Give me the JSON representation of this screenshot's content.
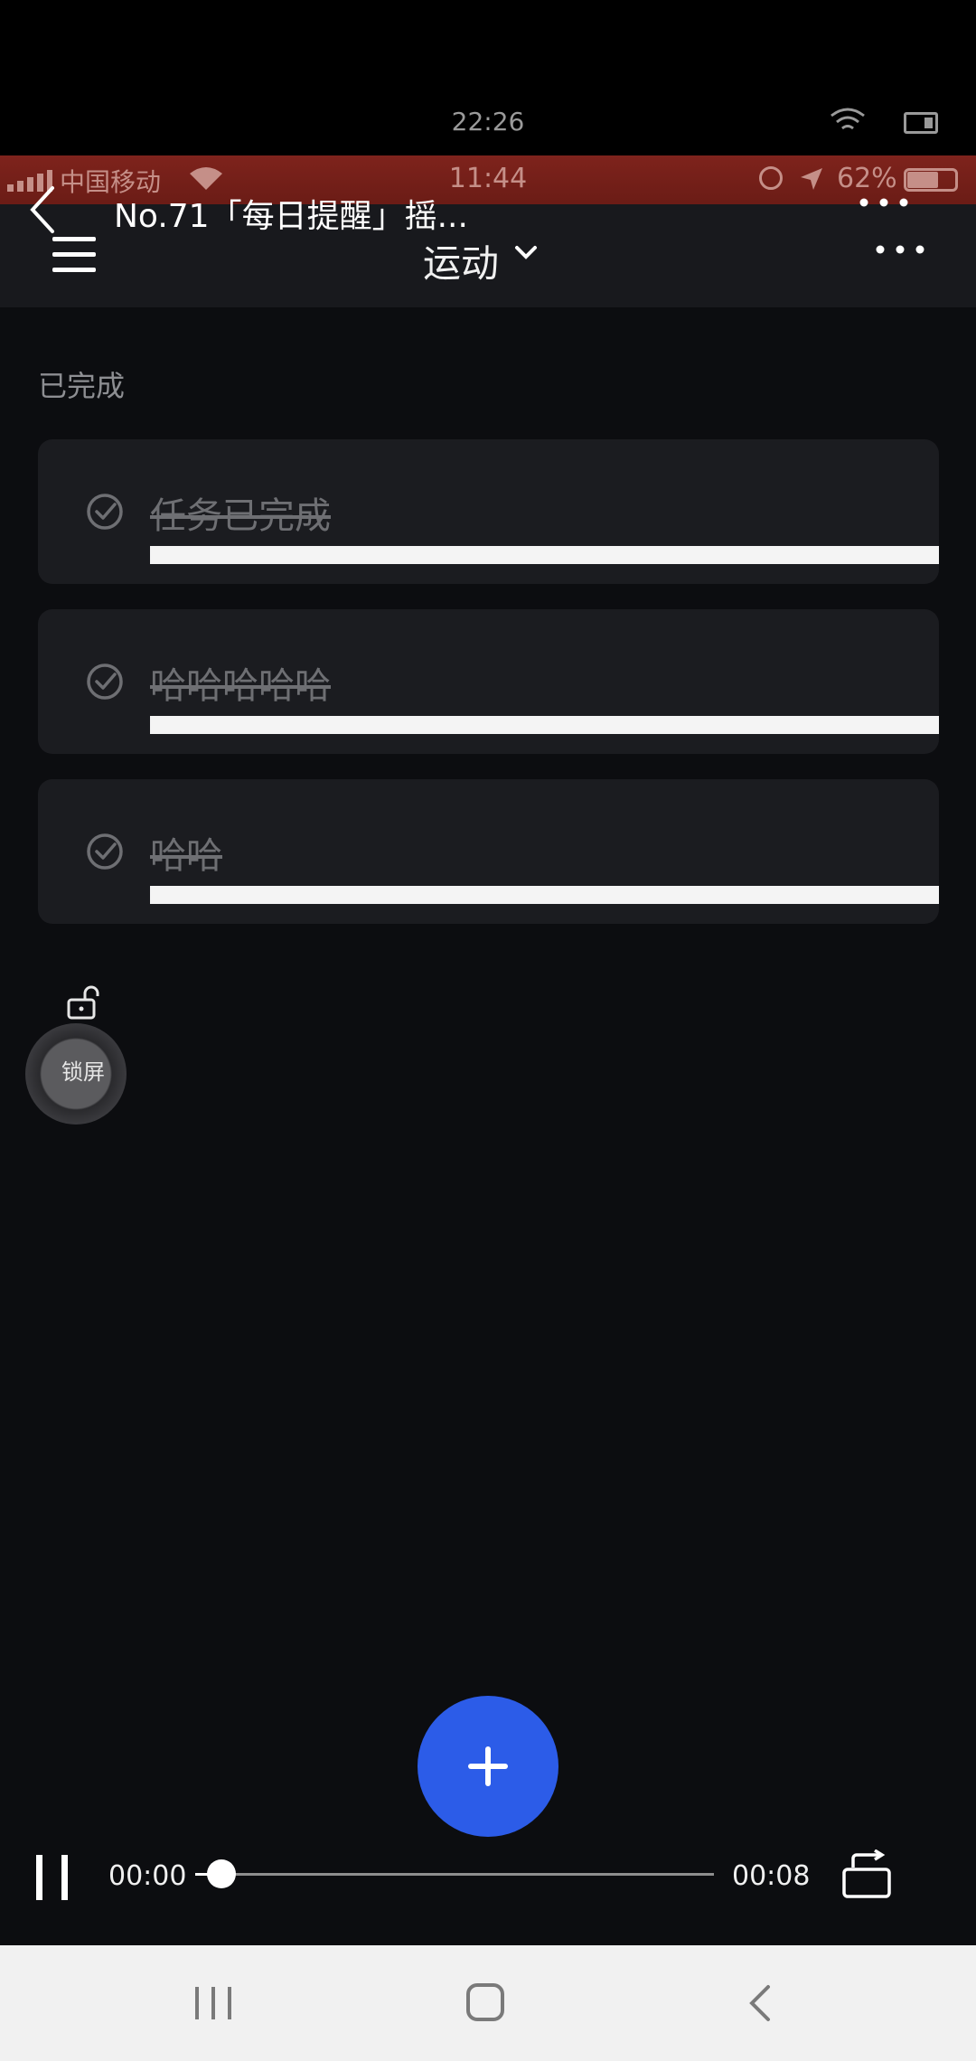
{
  "player_status": {
    "time": "22:26"
  },
  "recorded_status": {
    "carrier": "中国移动",
    "time": "11:44",
    "battery": "62%"
  },
  "overlay": {
    "title": "No.71「每日提醒」摇..."
  },
  "header": {
    "category": "运动"
  },
  "section": {
    "label": "已完成"
  },
  "tasks": [
    {
      "title": "任务已完成",
      "done": true
    },
    {
      "title": "哈哈哈哈哈",
      "done": true
    },
    {
      "title": "哈哈",
      "done": true
    }
  ],
  "lock_widget": {
    "label": "锁屏"
  },
  "video": {
    "current_time": "00:00",
    "total_time": "00:08",
    "progress": 0.05
  },
  "colors": {
    "accent": "#2c5ce8",
    "recording_bar": "#7e231c",
    "background": "#0c0d10"
  }
}
